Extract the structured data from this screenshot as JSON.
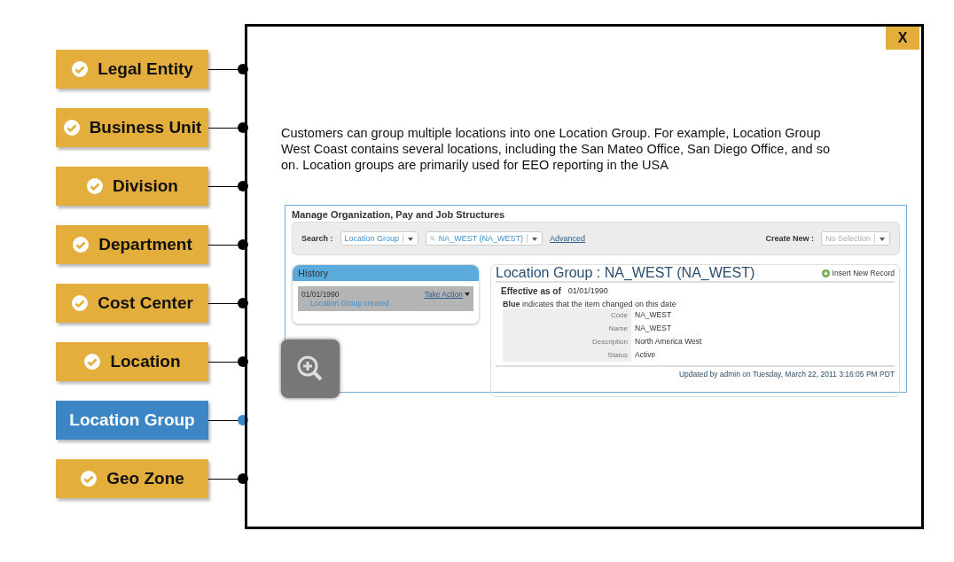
{
  "nav": [
    {
      "label": "Legal Entity",
      "visited": true,
      "selected": false
    },
    {
      "label": "Business Unit",
      "visited": true,
      "selected": false
    },
    {
      "label": "Division",
      "visited": true,
      "selected": false
    },
    {
      "label": "Department",
      "visited": true,
      "selected": false
    },
    {
      "label": "Cost Center",
      "visited": true,
      "selected": false
    },
    {
      "label": "Location",
      "visited": true,
      "selected": false
    },
    {
      "label": "Location Group",
      "visited": false,
      "selected": true
    },
    {
      "label": "Geo Zone",
      "visited": true,
      "selected": false
    }
  ],
  "close_button": "X",
  "description": "Customers can group multiple locations into one Location Group. For example, Location Group West Coast contains several locations, including the San Mateo Office, San Diego Office, and so on. Location groups are primarily used for EEO reporting in the USA",
  "screenshot": {
    "title": "Manage Organization, Pay and Job Structures",
    "search_label": "Search :",
    "search_type": "Location Group",
    "search_value": "NA_WEST (NA_WEST)",
    "advanced_link": "Advanced",
    "create_label": "Create New :",
    "create_value": "No Selection",
    "history": {
      "title": "History",
      "date": "01/01/1990",
      "action": "Take Action",
      "event": "Location Group created"
    },
    "record": {
      "title": "Location Group : NA_WEST (NA_WEST)",
      "insert": "Insert New Record",
      "effective_label": "Effective as of",
      "effective_date": "01/01/1990",
      "legend": "**Blue** indicates that the item changed on this date",
      "fields": [
        {
          "label": "Code",
          "value": "NA_WEST"
        },
        {
          "label": "Name",
          "value": "NA_WEST"
        },
        {
          "label": "Description",
          "value": "North America West"
        },
        {
          "label": "Status",
          "value": "Active"
        }
      ],
      "updated": "Updated by admin on Tuesday, March 22, 2011 3:16:05 PM PDT"
    }
  }
}
